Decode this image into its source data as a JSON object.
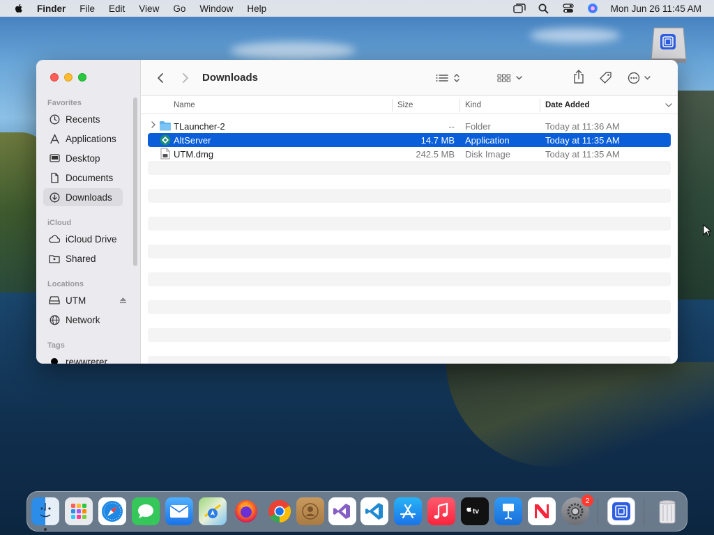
{
  "menubar": {
    "app_name": "Finder",
    "items": [
      "File",
      "Edit",
      "View",
      "Go",
      "Window",
      "Help"
    ],
    "datetime": "Mon Jun 26  11:45 AM"
  },
  "window": {
    "title": "Downloads",
    "sidebar": {
      "favorites_header": "Favorites",
      "favorites": [
        {
          "label": "Recents",
          "icon": "clock-icon"
        },
        {
          "label": "Applications",
          "icon": "applications-icon"
        },
        {
          "label": "Desktop",
          "icon": "desktop-icon"
        },
        {
          "label": "Documents",
          "icon": "document-icon"
        },
        {
          "label": "Downloads",
          "icon": "download-icon",
          "active": true
        }
      ],
      "icloud_header": "iCloud",
      "icloud": [
        {
          "label": "iCloud Drive",
          "icon": "cloud-icon"
        },
        {
          "label": "Shared",
          "icon": "shared-folder-icon"
        }
      ],
      "locations_header": "Locations",
      "locations": [
        {
          "label": "UTM",
          "icon": "drive-icon"
        },
        {
          "label": "Network",
          "icon": "globe-icon"
        }
      ],
      "tags_header": "Tags",
      "tags": [
        {
          "label": "rewwrerer",
          "color": "#000000"
        }
      ]
    },
    "columns": {
      "name": "Name",
      "size": "Size",
      "kind": "Kind",
      "date_added": "Date Added"
    },
    "files": [
      {
        "name": "TLauncher-2",
        "size": "--",
        "kind": "Folder",
        "date_added": "Today at 11:36 AM",
        "icon": "folder-icon",
        "selected": false
      },
      {
        "name": "AltServer",
        "size": "14.7 MB",
        "kind": "Application",
        "date_added": "Today at 11:35 AM",
        "icon": "altserver-app-icon",
        "selected": true
      },
      {
        "name": "UTM.dmg",
        "size": "242.5 MB",
        "kind": "Disk Image",
        "date_added": "Today at 11:35 AM",
        "icon": "disk-image-icon",
        "selected": false
      }
    ]
  },
  "dock": {
    "apps": [
      "finder-icon",
      "launchpad-icon",
      "safari-icon",
      "messages-icon",
      "mail-icon",
      "maps-icon",
      "firefox-icon",
      "chrome-icon",
      "contacts-icon",
      "visual-studio-icon",
      "vscode-icon",
      "app-store-icon",
      "music-icon",
      "apple-tv-icon",
      "keynote-icon",
      "news-icon",
      "system-preferences-icon"
    ],
    "system_preferences_badge": "2"
  },
  "colors": {
    "selection": "#0a5fd8",
    "red": "#ff5f57",
    "yellow": "#febc2e",
    "green": "#28c840"
  }
}
